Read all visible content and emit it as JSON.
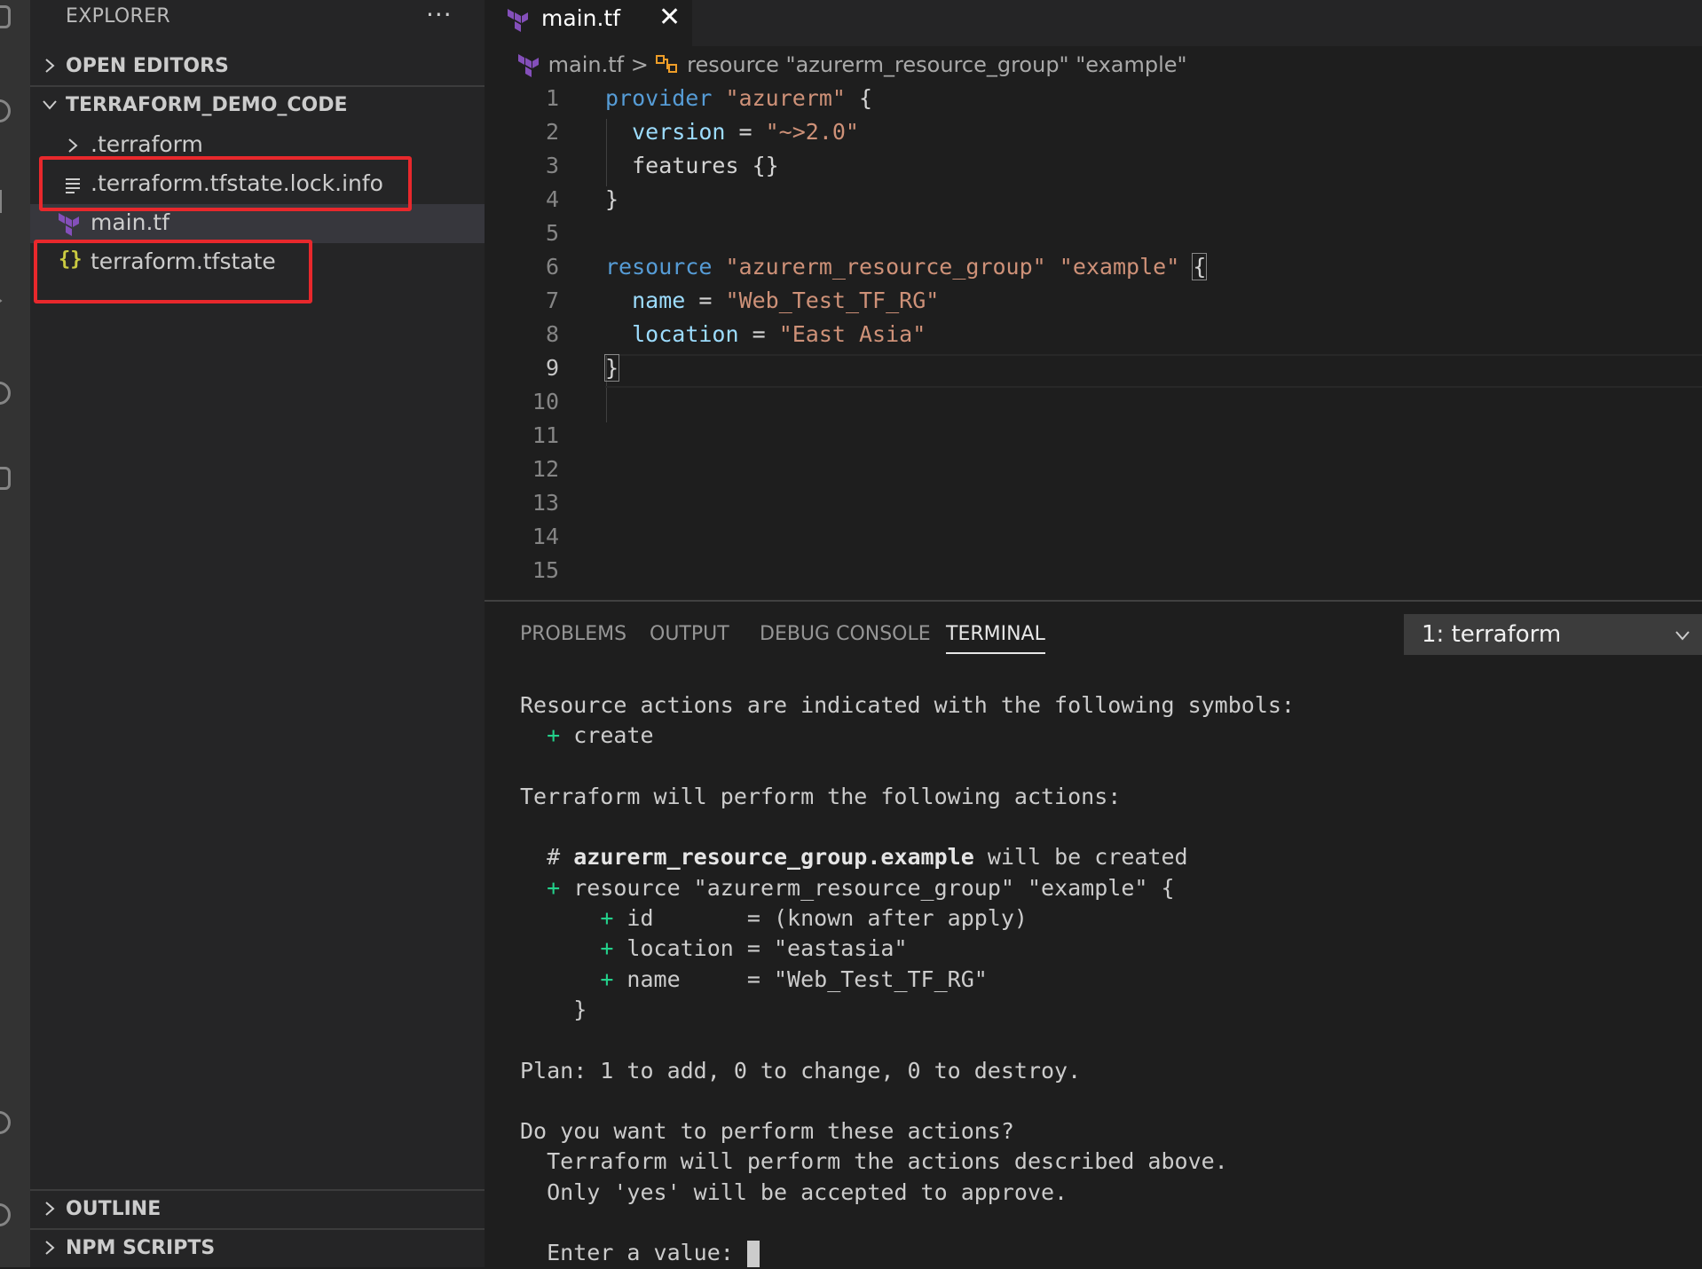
{
  "sidebar": {
    "title": "EXPLORER",
    "more_actions": "···",
    "open_editors": "OPEN EDITORS",
    "folder": "TERRAFORM_DEMO_CODE",
    "items": [
      {
        "label": ".terraform"
      },
      {
        "label": ".terraform.tfstate.lock.info"
      },
      {
        "label": "main.tf"
      },
      {
        "label": "terraform.tfstate",
        "icon_text": "{}"
      }
    ],
    "outline": "OUTLINE",
    "npm_scripts": "NPM SCRIPTS"
  },
  "editor": {
    "tab_label": "main.tf",
    "tab_close": "✕",
    "breadcrumb": {
      "file": "main.tf",
      "separator": ">",
      "symbol": "resource \"azurerm_resource_group\" \"example\""
    },
    "line_numbers": [
      "1",
      "2",
      "3",
      "4",
      "5",
      "6",
      "7",
      "8",
      "9",
      "10",
      "11",
      "12",
      "13",
      "14",
      "15"
    ],
    "code": {
      "l1_kw": "provider",
      "l1_str": "\"azurerm\"",
      "l1_rest": " {",
      "l2_attr": "version",
      "l2_eq": " = ",
      "l2_str": "\"~>2.0\"",
      "l3_text": "features {}",
      "l4_text": "}",
      "l6_kw": "resource",
      "l6_str1": "\"azurerm_resource_group\"",
      "l6_str2": "\"example\"",
      "l6_brace": "{",
      "l7_attr": "name",
      "l7_eq": " = ",
      "l7_str": "\"Web_Test_TF_RG\"",
      "l8_attr": "location",
      "l8_eq": " = ",
      "l8_str": "\"East Asia\"",
      "l9_brace": "}"
    }
  },
  "panel": {
    "tabs": [
      "PROBLEMS",
      "OUTPUT",
      "DEBUG CONSOLE",
      "TERMINAL"
    ],
    "active_tab": "TERMINAL",
    "terminal_select": "1: terraform",
    "terminal": {
      "t1": "Resource actions are indicated with the following symbols:",
      "t2_plus": "+",
      "t2_text": " create",
      "t4": "Terraform will perform the following actions:",
      "t6_hash": "# ",
      "t6_bold": "azurerm_resource_group.example",
      "t6_rest": " will be created",
      "t7_plus": "+",
      "t7_text": " resource \"azurerm_resource_group\" \"example\" {",
      "t8_plus": "+",
      "t8_text": " id       = (known after apply)",
      "t9_plus": "+",
      "t9_text": " location = \"eastasia\"",
      "t10_plus": "+",
      "t10_text": " name     = \"Web_Test_TF_RG\"",
      "t11": "}",
      "t13": "Plan: 1 to add, 0 to change, 0 to destroy.",
      "t15": "Do you want to perform these actions?",
      "t16": "Terraform will perform the actions described above.",
      "t17": "Only 'yes' will be accepted to approve.",
      "t19": "Enter a value: "
    }
  },
  "colors": {
    "keyword": "#569cd6",
    "string": "#ce9178",
    "attribute": "#9cdcfe",
    "terraform_icon": "#844fba",
    "highlight_box": "#e8282c",
    "terminal_plus": "#23d18b"
  }
}
